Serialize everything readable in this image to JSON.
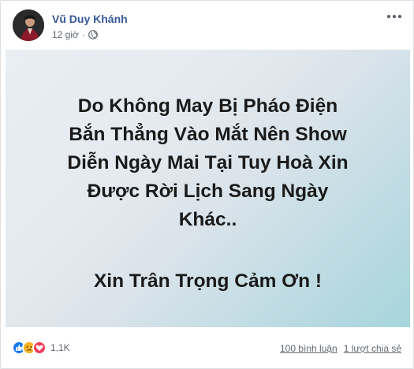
{
  "post": {
    "author": "Vũ Duy Khánh",
    "time": "12 giờ",
    "separator": "·"
  },
  "image": {
    "headline_lines": [
      "Do Không May Bị Pháo Điện",
      "Bắn Thẳng Vào Mắt Nên Show",
      "Diễn Ngày Mai Tại Tuy Hoà Xin",
      "Được Rời Lịch Sang Ngày",
      "Khác.."
    ],
    "thanks": "Xin Trân Trọng Cảm Ơn !"
  },
  "footer": {
    "reaction_count": "1,1K",
    "comments": "100 bình luận",
    "shares": "1 lượt chia sẻ"
  },
  "icons": {
    "more": "more-horizontal-icon",
    "privacy": "globe-icon",
    "reactions": [
      "like-icon",
      "sad-icon",
      "love-icon"
    ]
  },
  "colors": {
    "author": "#385898",
    "like": "#1877f2",
    "sad": "#f7b125",
    "love": "#f33e58"
  }
}
